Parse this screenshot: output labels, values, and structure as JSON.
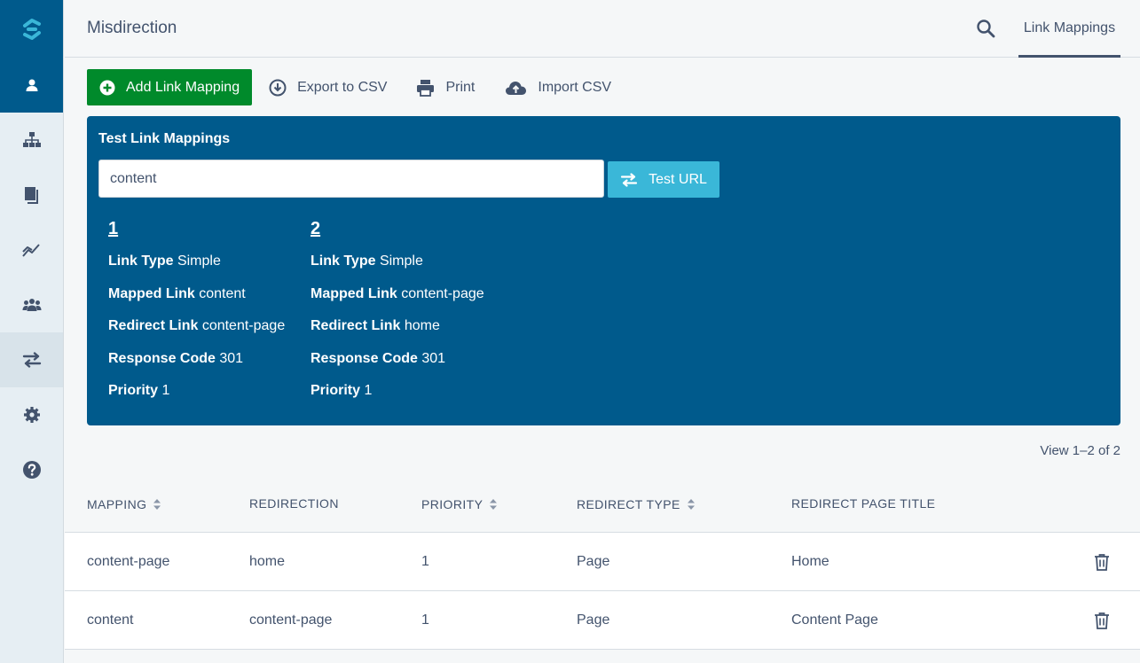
{
  "app": {
    "title": "Misdirection",
    "tab_label": "Link Mappings"
  },
  "sidebar": {
    "items": [
      {
        "name": "user-icon",
        "active": "dark"
      },
      {
        "name": "sitemap-icon"
      },
      {
        "name": "pages-icon"
      },
      {
        "name": "chart-line-icon"
      },
      {
        "name": "users-icon"
      },
      {
        "name": "exchange-icon",
        "active": "light"
      },
      {
        "name": "gear-icon"
      },
      {
        "name": "help-icon"
      }
    ]
  },
  "toolbar": {
    "add_label": "Add Link Mapping",
    "export_label": "Export to CSV",
    "print_label": "Print",
    "import_label": "Import CSV"
  },
  "test": {
    "title": "Test Link Mappings",
    "input_value": "content",
    "button_label": "Test URL",
    "results": [
      {
        "index": "1",
        "link_type_label": "Link Type",
        "link_type": "Simple",
        "mapped_label": "Mapped Link",
        "mapped": "content",
        "redirect_label": "Redirect Link",
        "redirect": "content-page",
        "code_label": "Response Code",
        "code": "301",
        "priority_label": "Priority",
        "priority": "1"
      },
      {
        "index": "2",
        "link_type_label": "Link Type",
        "link_type": "Simple",
        "mapped_label": "Mapped Link",
        "mapped": "content-page",
        "redirect_label": "Redirect Link",
        "redirect": "home",
        "code_label": "Response Code",
        "code": "301",
        "priority_label": "Priority",
        "priority": "1"
      }
    ]
  },
  "count_text": "View 1–2 of 2",
  "table": {
    "headers": {
      "mapping": "MAPPING",
      "redirection": "REDIRECTION",
      "priority": "PRIORITY",
      "redirect_type": "REDIRECT TYPE",
      "page_title": "REDIRECT PAGE TITLE"
    },
    "rows": [
      {
        "mapping": "content-page",
        "redirection": "home",
        "priority": "1",
        "type": "Page",
        "title": "Home"
      },
      {
        "mapping": "content",
        "redirection": "content-page",
        "priority": "1",
        "type": "Page",
        "title": "Content Page"
      }
    ]
  },
  "colors": {
    "brand_blue": "#005a8c",
    "add_green": "#008a2b",
    "test_button": "#3ab7d8",
    "text": "#43536d"
  }
}
